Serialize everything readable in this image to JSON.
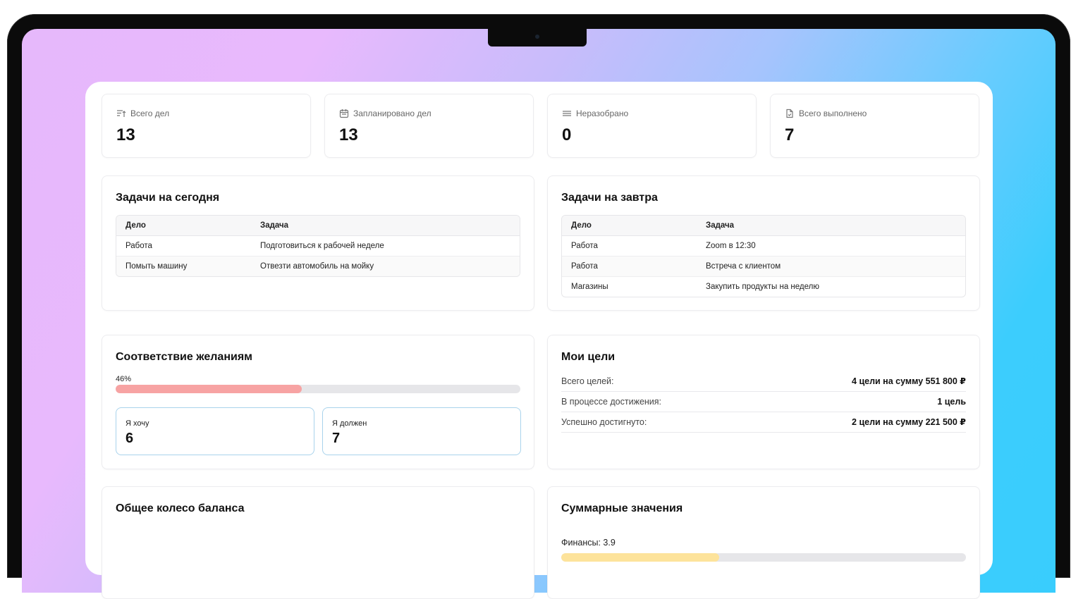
{
  "stats": [
    {
      "icon": "sort-up-icon",
      "label": "Всего дел",
      "value": "13"
    },
    {
      "icon": "calendar-icon",
      "label": "Запланировано дел",
      "value": "13"
    },
    {
      "icon": "menu-lines-icon",
      "label": "Неразобрано",
      "value": "0"
    },
    {
      "icon": "document-check-icon",
      "label": "Всего выполнено",
      "value": "7"
    }
  ],
  "today": {
    "title": "Задачи на сегодня",
    "headers": [
      "Дело",
      "Задача"
    ],
    "rows": [
      [
        "Работа",
        "Подготовиться к рабочей неделе"
      ],
      [
        "Помыть машину",
        "Отвезти автомобиль на мойку"
      ]
    ]
  },
  "tomorrow": {
    "title": "Задачи на завтра",
    "headers": [
      "Дело",
      "Задача"
    ],
    "rows": [
      [
        "Работа",
        "Zoom в 12:30"
      ],
      [
        "Работа",
        "Встреча с клиентом"
      ],
      [
        "Магазины",
        "Закупить продукты на неделю"
      ]
    ]
  },
  "wishes": {
    "title": "Соответствие желаниям",
    "percent_label": "46%",
    "percent": 46,
    "bar_color": "#f7a3a3",
    "want_label": "Я хочу",
    "want_value": "6",
    "must_label": "Я должен",
    "must_value": "7"
  },
  "goals": {
    "title": "Мои цели",
    "rows": [
      {
        "key": "Всего целей:",
        "value": "4 цели на сумму 551 800 ₽"
      },
      {
        "key": "В процессе достижения:",
        "value": "1 цель"
      },
      {
        "key": "Успешно достигнуто:",
        "value": "2 цели на сумму 221 500 ₽"
      }
    ]
  },
  "balance": {
    "title": "Общее колесо баланса"
  },
  "summary": {
    "title": "Суммарные значения",
    "finance_label": "Финансы: 3.9",
    "finance_value": 3.9,
    "finance_max": 10,
    "bar_color": "#fde39b"
  }
}
